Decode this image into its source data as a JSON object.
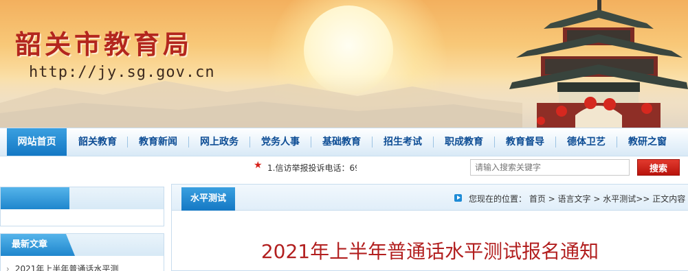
{
  "site": {
    "title": "韶关市教育局",
    "url": "http://jy.sg.gov.cn"
  },
  "nav": {
    "items": [
      {
        "label": "网站首页",
        "active": true
      },
      {
        "label": "韶关教育"
      },
      {
        "label": "教育新闻"
      },
      {
        "label": "网上政务"
      },
      {
        "label": "党务人事"
      },
      {
        "label": "基础教育"
      },
      {
        "label": "招生考试"
      },
      {
        "label": "职成教育"
      },
      {
        "label": "教育督导"
      },
      {
        "label": "德体卫艺"
      },
      {
        "label": "教研之窗"
      }
    ]
  },
  "infobar": {
    "ticker": "1.信访举报投诉电话：69",
    "search_placeholder": "请输入搜索关键字",
    "search_button": "搜索"
  },
  "sidebar": {
    "latest_title": "最新文章",
    "latest_items": [
      "2021年上半年普通话水平测"
    ]
  },
  "main": {
    "tab": "水平测试",
    "breadcrumb": {
      "prefix": "您现在的位置：",
      "items": [
        "首页",
        "语言文字",
        "水平测试",
        "正文内容"
      ]
    },
    "article_title": "2021年上半年普通话水平测试报名通知"
  },
  "colors": {
    "nav_text": "#0c4c94",
    "nav_active": "#1478c4",
    "title_red": "#b21f1f",
    "search_red": "#c81a12"
  }
}
